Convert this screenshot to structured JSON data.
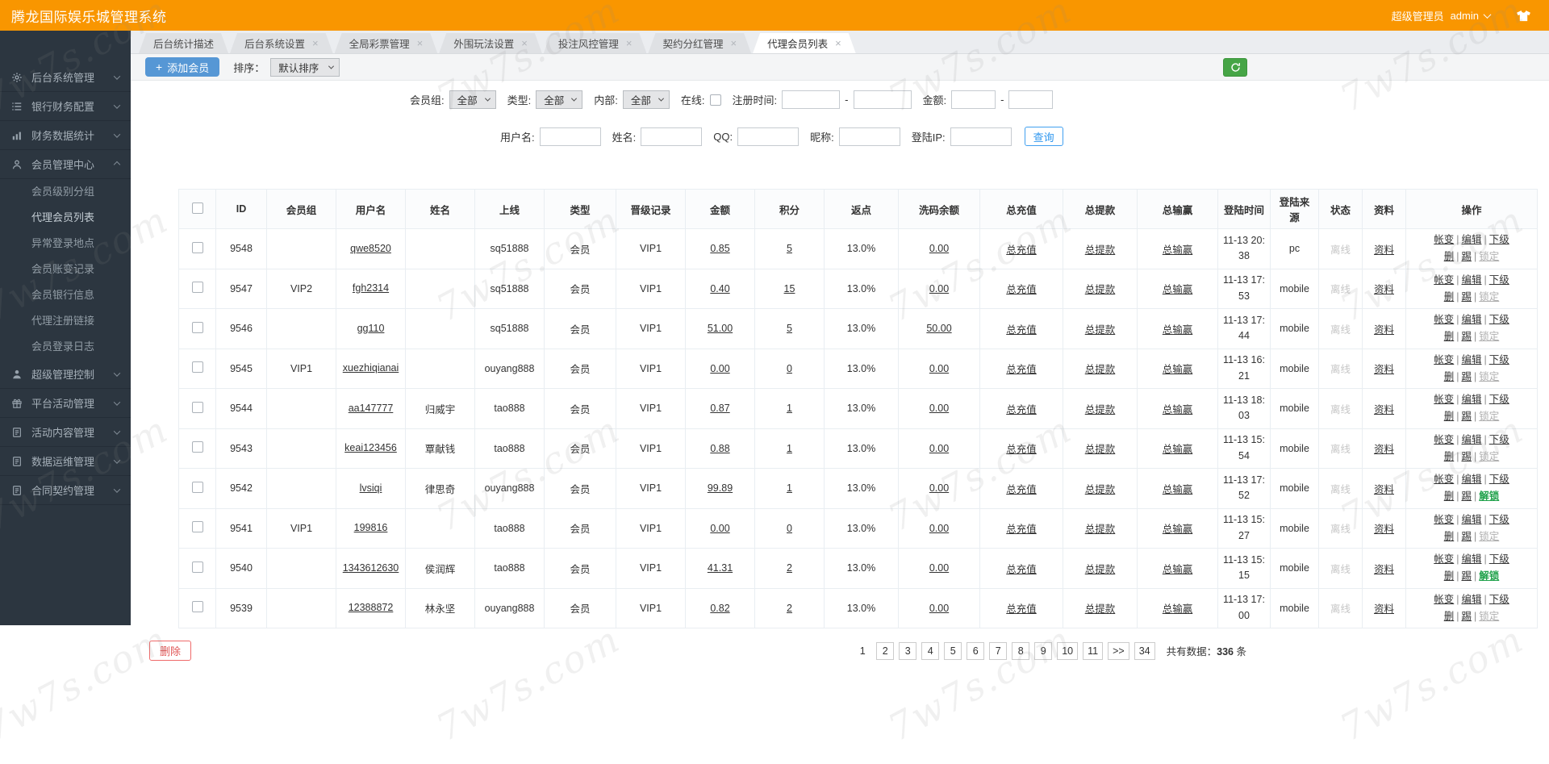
{
  "watermark": "7w7s.com",
  "header": {
    "title": "腾龙国际娱乐城管理系统",
    "role": "超级管理员",
    "user": "admin"
  },
  "icons": {
    "add_button": "plus-icon",
    "refresh_button": "refresh-icon",
    "user_chevron": "chevron-down-icon",
    "theme_button": "shirt-icon",
    "tab_close": "close-icon"
  },
  "sidebar": {
    "items": [
      {
        "label": "后台系统管理",
        "icon": "gear-icon",
        "expanded": false
      },
      {
        "label": "银行财务配置",
        "icon": "list-icon",
        "expanded": false
      },
      {
        "label": "财务数据统计",
        "icon": "chart-icon",
        "expanded": false
      },
      {
        "label": "会员管理中心",
        "icon": "user-icon",
        "expanded": true,
        "children": [
          "会员级别分组",
          "代理会员列表",
          "异常登录地点",
          "会员账变记录",
          "会员银行信息",
          "代理注册链接",
          "会员登录日志"
        ],
        "active_child": "代理会员列表"
      },
      {
        "label": "超级管理控制",
        "icon": "admin-icon",
        "expanded": false
      },
      {
        "label": "平台活动管理",
        "icon": "gift-icon",
        "expanded": false
      },
      {
        "label": "活动内容管理",
        "icon": "doc-icon",
        "expanded": false
      },
      {
        "label": "数据运维管理",
        "icon": "doc-icon",
        "expanded": false
      },
      {
        "label": "合同契约管理",
        "icon": "doc-icon",
        "expanded": false
      }
    ]
  },
  "tabs": [
    {
      "label": "后台统计描述",
      "closable": false,
      "active": false
    },
    {
      "label": "后台系统设置",
      "closable": true,
      "active": false
    },
    {
      "label": "全局彩票管理",
      "closable": true,
      "active": false
    },
    {
      "label": "外围玩法设置",
      "closable": true,
      "active": false
    },
    {
      "label": "投注风控管理",
      "closable": true,
      "active": false
    },
    {
      "label": "契约分红管理",
      "closable": true,
      "active": false
    },
    {
      "label": "代理会员列表",
      "closable": true,
      "active": true
    }
  ],
  "toolbar": {
    "add_button": "添加会员",
    "sort_label": "排序：",
    "sort_value": "默认排序"
  },
  "filters": {
    "row1": {
      "group_label": "会员组:",
      "group_value": "全部",
      "type_label": "类型:",
      "type_value": "全部",
      "internal_label": "内部:",
      "internal_value": "全部",
      "online_label": "在线:",
      "regtime_label": "注册时间:",
      "dash": "-",
      "amount_label": "金额:"
    },
    "row2": {
      "username_label": "用户名:",
      "name_label": "姓名:",
      "qq_label": "QQ:",
      "nick_label": "昵称:",
      "ip_label": "登陆IP:",
      "search_button": "查询"
    }
  },
  "table": {
    "headers": [
      "ID",
      "会员组",
      "用户名",
      "姓名",
      "上线",
      "类型",
      "晋级记录",
      "金额",
      "积分",
      "返点",
      "洗码余额",
      "总充值",
      "总提款",
      "总输赢",
      "登陆时间",
      "登陆来源",
      "状态",
      "资料",
      "操作"
    ],
    "cell_links": {
      "recharge": "总充值",
      "withdraw": "总提款",
      "winloss": "总输赢",
      "profile": "资料"
    },
    "ops_line1": [
      "帐变",
      "编辑",
      "下级"
    ],
    "ops_line2": [
      "删",
      "踢"
    ],
    "sep": "|",
    "rows": [
      {
        "id": "9548",
        "group": "",
        "username": "qwe8520",
        "name": "",
        "upline": "sq51888",
        "type": "会员",
        "vip": "VIP1",
        "amount": "0.85",
        "points": "5",
        "rebate": "13.0%",
        "wash": "0.00",
        "login_time": "11-13 20:38",
        "source": "pc",
        "status": "离线",
        "lock": "锁定",
        "unlock": false
      },
      {
        "id": "9547",
        "group": "VIP2",
        "username": "fgh2314",
        "name": "",
        "upline": "sq51888",
        "type": "会员",
        "vip": "VIP1",
        "amount": "0.40",
        "points": "15",
        "rebate": "13.0%",
        "wash": "0.00",
        "login_time": "11-13 17:53",
        "source": "mobile",
        "status": "离线",
        "lock": "锁定",
        "unlock": false
      },
      {
        "id": "9546",
        "group": "",
        "username": "gg110",
        "name": "",
        "upline": "sq51888",
        "type": "会员",
        "vip": "VIP1",
        "amount": "51.00",
        "points": "5",
        "rebate": "13.0%",
        "wash": "50.00",
        "login_time": "11-13 17:44",
        "source": "mobile",
        "status": "离线",
        "lock": "锁定",
        "unlock": false
      },
      {
        "id": "9545",
        "group": "VIP1",
        "username": "xuezhiqianai",
        "name": "",
        "upline": "ouyang888",
        "type": "会员",
        "vip": "VIP1",
        "amount": "0.00",
        "points": "0",
        "rebate": "13.0%",
        "wash": "0.00",
        "login_time": "11-13 16:21",
        "source": "mobile",
        "status": "离线",
        "lock": "锁定",
        "unlock": false
      },
      {
        "id": "9544",
        "group": "",
        "username": "aa147777",
        "name": "归威宇",
        "upline": "tao888",
        "type": "会员",
        "vip": "VIP1",
        "amount": "0.87",
        "points": "1",
        "rebate": "13.0%",
        "wash": "0.00",
        "login_time": "11-13 18:03",
        "source": "mobile",
        "status": "离线",
        "lock": "锁定",
        "unlock": false
      },
      {
        "id": "9543",
        "group": "",
        "username": "keai123456",
        "name": "覃献钱",
        "upline": "tao888",
        "type": "会员",
        "vip": "VIP1",
        "amount": "0.88",
        "points": "1",
        "rebate": "13.0%",
        "wash": "0.00",
        "login_time": "11-13 15:54",
        "source": "mobile",
        "status": "离线",
        "lock": "锁定",
        "unlock": false
      },
      {
        "id": "9542",
        "group": "",
        "username": "lvsiqi",
        "name": "律思奇",
        "upline": "ouyang888",
        "type": "会员",
        "vip": "VIP1",
        "amount": "99.89",
        "points": "1",
        "rebate": "13.0%",
        "wash": "0.00",
        "login_time": "11-13 17:52",
        "source": "mobile",
        "status": "离线",
        "lock": "解锁",
        "unlock": true
      },
      {
        "id": "9541",
        "group": "VIP1",
        "username": "199816",
        "name": "",
        "upline": "tao888",
        "type": "会员",
        "vip": "VIP1",
        "amount": "0.00",
        "points": "0",
        "rebate": "13.0%",
        "wash": "0.00",
        "login_time": "11-13 15:27",
        "source": "mobile",
        "status": "离线",
        "lock": "锁定",
        "unlock": false
      },
      {
        "id": "9540",
        "group": "",
        "username": "1343612630",
        "name": "侯润辉",
        "upline": "tao888",
        "type": "会员",
        "vip": "VIP1",
        "amount": "41.31",
        "points": "2",
        "rebate": "13.0%",
        "wash": "0.00",
        "login_time": "11-13 15:15",
        "source": "mobile",
        "status": "离线",
        "lock": "解锁",
        "unlock": true
      },
      {
        "id": "9539",
        "group": "",
        "username": "12388872",
        "name": "林永坚",
        "upline": "ouyang888",
        "type": "会员",
        "vip": "VIP1",
        "amount": "0.82",
        "points": "2",
        "rebate": "13.0%",
        "wash": "0.00",
        "login_time": "11-13 17:00",
        "source": "mobile",
        "status": "离线",
        "lock": "锁定",
        "unlock": false
      }
    ]
  },
  "pagination": {
    "pages": [
      "1",
      "2",
      "3",
      "4",
      "5",
      "6",
      "7",
      "8",
      "9",
      "10",
      "11",
      ">>",
      "34"
    ],
    "current": "1",
    "total_label": "共有数据：",
    "total_value": "336",
    "total_unit": "条"
  },
  "footer": {
    "delete_button": "删除"
  }
}
